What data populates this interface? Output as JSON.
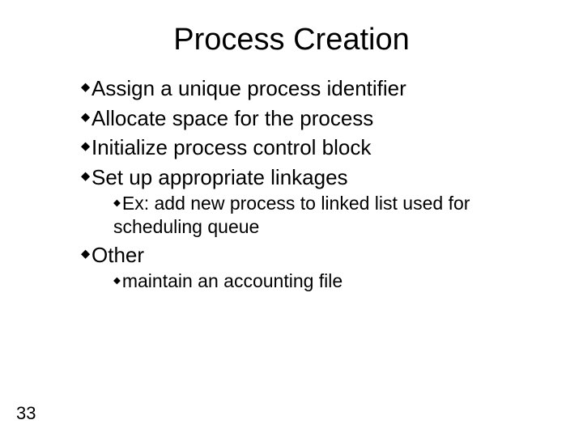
{
  "title": "Process Creation",
  "bullets": {
    "b1": "Assign a unique process identifier",
    "b2": "Allocate space for the process",
    "b3": "Initialize process control block",
    "b4": "Set up appropriate linkages",
    "b4_sub": "Ex: add new process to linked list used for scheduling queue",
    "b5": "Other",
    "b5_sub": "maintain an accounting file"
  },
  "page_number": "33"
}
